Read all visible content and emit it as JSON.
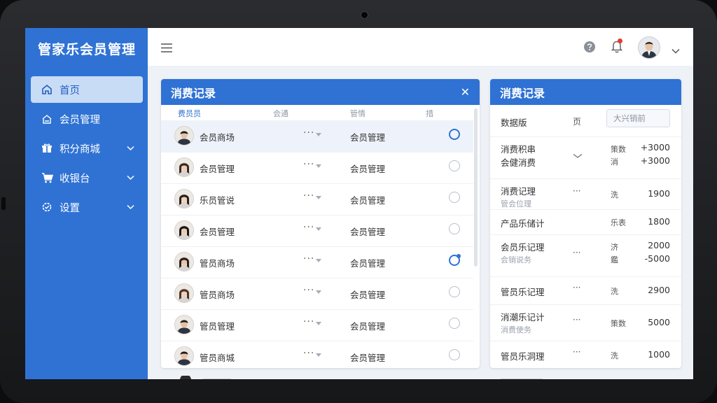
{
  "app": {
    "title": "管家乐会员管理"
  },
  "sidebar": {
    "items": [
      {
        "label": "首页",
        "icon": "home-icon",
        "active": true
      },
      {
        "label": "会员管理",
        "icon": "house-outline-icon"
      },
      {
        "label": "积分商城",
        "icon": "gift-icon",
        "expandable": true
      },
      {
        "label": "收银台",
        "icon": "cart-icon",
        "expandable": true
      },
      {
        "label": "设置",
        "icon": "gear-icon",
        "expandable": true
      }
    ]
  },
  "header": {
    "menu_icon": "hamburger-icon",
    "help_icon": "help-icon",
    "bell_icon": "bell-icon",
    "user_menu_icon": "chevron-down-icon"
  },
  "records": {
    "title": "消费记录",
    "columns": [
      "费员员",
      "会通",
      "管情",
      "措"
    ],
    "rows": [
      {
        "name": "会员商场",
        "col3": "会员管理",
        "selected": true
      },
      {
        "name": "会员管理",
        "col3": "会员管理"
      },
      {
        "name": "乐员管说",
        "col3": "会员管理"
      },
      {
        "name": "会员管理",
        "col3": "会员管理"
      },
      {
        "name": "管员商场",
        "col3": "会员管理",
        "flag": true
      },
      {
        "name": "管员商场",
        "col3": "会员管理"
      },
      {
        "name": "管员管理",
        "col3": "会员管理"
      },
      {
        "name": "管员商城",
        "col3": "会员管理"
      }
    ]
  },
  "summary": {
    "title": "消费记录",
    "filter_label": "数据版",
    "filter_mid": "页",
    "search_placeholder": "大兴销前",
    "rows": [
      {
        "t1": "消费积串",
        "t1b": "会健消费",
        "c3": "策数",
        "c3b": "消",
        "v1": "+3000",
        "v2": "+3000"
      },
      {
        "t1": "消费记理",
        "t2": "管会位理",
        "c3": "洗",
        "v1": "1900"
      },
      {
        "t1": "产品乐储计",
        "c3": "乐表",
        "v1": "1800"
      },
      {
        "t1": "会员乐记理",
        "t2": "会销说务",
        "c3": "济",
        "c3b": "鑑",
        "v1": "2000",
        "v2": "-5000"
      },
      {
        "t1": "管员乐记理",
        "c3": "洗",
        "v1": "2900"
      },
      {
        "t1": "消潮乐记计",
        "t2": "消费使务",
        "c3": "策数",
        "v1": "5000"
      },
      {
        "t1": "管员乐洞理",
        "c3": "洗",
        "v1": "1000"
      }
    ]
  }
}
